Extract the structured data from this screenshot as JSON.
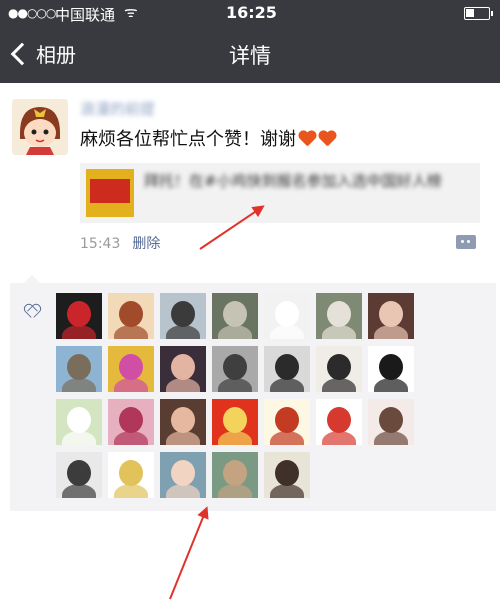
{
  "status_bar": {
    "signal": "●●○○○",
    "carrier": "中国联通",
    "wifi": "ᯤ",
    "time": "16:25"
  },
  "nav": {
    "back_label": "相册",
    "title": "详情"
  },
  "post": {
    "username": "浪漫的前提",
    "content": "麻烦各位帮忙点个赞！谢谢",
    "shared_text": "拜托！在#小鸡快到报名参加入选中国好人榜",
    "time": "15:43",
    "delete_label": "删除"
  },
  "likes": {
    "colors": {
      "accent": "#576b95"
    },
    "avatars": [
      {
        "name": "liker-1",
        "icon": "red-rose",
        "bg": "#1d1d1d",
        "fg": "#c9252b"
      },
      {
        "name": "liker-2",
        "icon": "cartoon-girl",
        "bg": "#f2d9b8",
        "fg": "#a14b2b"
      },
      {
        "name": "liker-3",
        "icon": "man-photo",
        "bg": "#b7c3cd",
        "fg": "#3b3b3b"
      },
      {
        "name": "liker-4",
        "icon": "landscape",
        "bg": "#6a7462",
        "fg": "#c6c3b4"
      },
      {
        "name": "liker-5",
        "icon": "cartoon-pig",
        "bg": "#f2f2f2",
        "fg": "#ffffff"
      },
      {
        "name": "liker-6",
        "icon": "child-photo",
        "bg": "#7f8a74",
        "fg": "#e5e1d8"
      },
      {
        "name": "liker-7",
        "icon": "woman-photo",
        "bg": "#5c3b35",
        "fg": "#e9c5b4"
      },
      {
        "name": "liker-8",
        "icon": "animal-photo",
        "bg": "#8db4d3",
        "fg": "#7b6d5c"
      },
      {
        "name": "liker-9",
        "icon": "rainbow-figure",
        "bg": "#e5b93c",
        "fg": "#d04fa5"
      },
      {
        "name": "liker-10",
        "icon": "girl-photo",
        "bg": "#3a2e3b",
        "fg": "#e4b4a3"
      },
      {
        "name": "liker-11",
        "icon": "collage",
        "bg": "#a9a9a9",
        "fg": "#3f3f3f"
      },
      {
        "name": "liker-12",
        "icon": "hat-person",
        "bg": "#d9d9d9",
        "fg": "#2b2b2b"
      },
      {
        "name": "liker-13",
        "icon": "sunglasses-woman",
        "bg": "#f0ede7",
        "fg": "#2c2b2b"
      },
      {
        "name": "liker-14",
        "icon": "meme",
        "bg": "#ffffff",
        "fg": "#1a1a1a"
      },
      {
        "name": "liker-15",
        "icon": "plant",
        "bg": "#d3e6c1",
        "fg": "#ffffff"
      },
      {
        "name": "liker-16",
        "icon": "pink-figure",
        "bg": "#e6b0c0",
        "fg": "#b0365a"
      },
      {
        "name": "liker-17",
        "icon": "woman-face",
        "bg": "#5a3d32",
        "fg": "#e6b89f"
      },
      {
        "name": "liker-18",
        "icon": "red-badge",
        "bg": "#e0321d",
        "fg": "#f4d35c"
      },
      {
        "name": "liker-19",
        "icon": "round-seal",
        "bg": "#fdf8e3",
        "fg": "#c23b22"
      },
      {
        "name": "liker-20",
        "icon": "anime-pirate",
        "bg": "#ffffff",
        "fg": "#d63a2f"
      },
      {
        "name": "liker-21",
        "icon": "girl-smile",
        "bg": "#f4eae8",
        "fg": "#6b4a3e"
      },
      {
        "name": "liker-22",
        "icon": "sketch-portrait",
        "bg": "#e9e9e9",
        "fg": "#3c3c3c"
      },
      {
        "name": "liker-23",
        "icon": "anime-girl",
        "bg": "#ffffff",
        "fg": "#e1c25b"
      },
      {
        "name": "liker-24",
        "icon": "baby-photo",
        "bg": "#7fa0b0",
        "fg": "#f1d4c2"
      },
      {
        "name": "liker-25",
        "icon": "outdoor-photo",
        "bg": "#7a9a83",
        "fg": "#c4a382"
      },
      {
        "name": "liker-26",
        "icon": "woman-portrait",
        "bg": "#e9e4d8",
        "fg": "#40302a"
      }
    ]
  }
}
